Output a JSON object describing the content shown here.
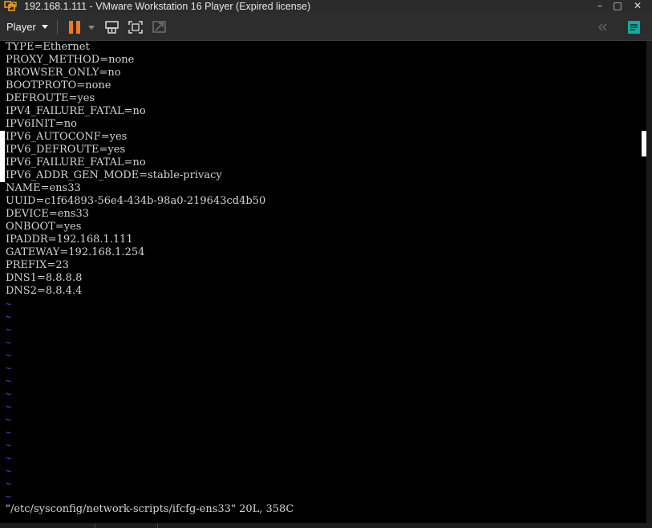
{
  "window": {
    "title": "192.168.1.111 - VMware Workstation 16 Player (Expired license)",
    "controls": {
      "minimize": "–",
      "maximize": "□",
      "close": "✕"
    }
  },
  "toolbar": {
    "player_label": "Player",
    "accent_color": "#f07a22"
  },
  "terminal": {
    "lines": [
      "TYPE=Ethernet",
      "PROXY_METHOD=none",
      "BROWSER_ONLY=no",
      "BOOTPROTO=none",
      "DEFROUTE=yes",
      "IPV4_FAILURE_FATAL=no",
      "IPV6INIT=no",
      "IPV6_AUTOCONF=yes",
      "IPV6_DEFROUTE=yes",
      "IPV6_FAILURE_FATAL=no",
      "IPV6_ADDR_GEN_MODE=stable-privacy",
      "NAME=ens33",
      "UUID=c1f64893-56e4-434b-98a0-219643cd4b50",
      "DEVICE=ens33",
      "ONBOOT=yes",
      "IPADDR=192.168.1.111",
      "GATEWAY=192.168.1.254",
      "PREFIX=23",
      "DNS1=8.8.8.8",
      "DNS2=8.8.4.4"
    ],
    "tilde_char": "~",
    "tilde_color": "#3b4fd9",
    "status_line": "\"/etc/sysconfig/network-scripts/ifcfg-ens33\" 20L, 358C"
  }
}
